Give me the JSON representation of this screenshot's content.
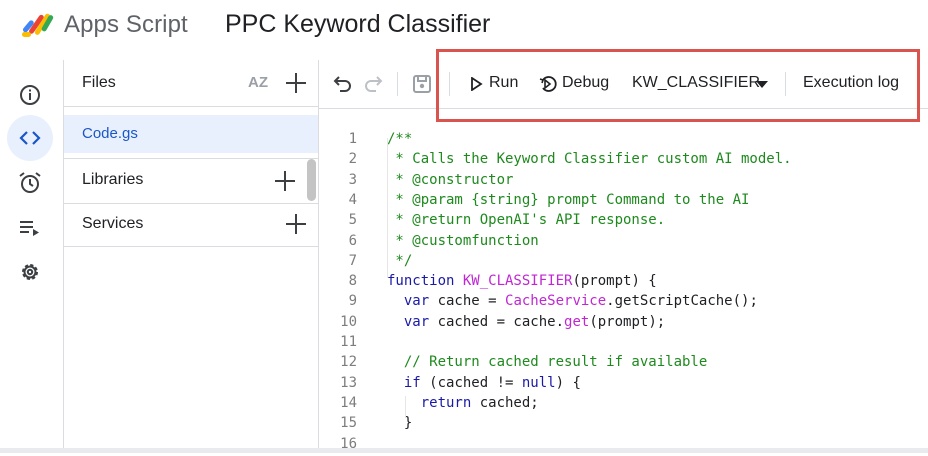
{
  "header": {
    "app_name": "Apps Script",
    "project_title": "PPC Keyword Classifier"
  },
  "rail": {
    "items": [
      "overview",
      "editor",
      "triggers",
      "executions",
      "settings"
    ],
    "active": "editor"
  },
  "files_panel": {
    "title": "Files",
    "files": [
      "Code.gs"
    ],
    "libraries_label": "Libraries",
    "services_label": "Services"
  },
  "toolbar": {
    "run_label": "Run",
    "debug_label": "Debug",
    "function_select": "KW_CLASSIFIER",
    "execution_log_label": "Execution log"
  },
  "code": {
    "lines": [
      {
        "n": "1",
        "parts": [
          {
            "s": "/**",
            "c": "c"
          }
        ]
      },
      {
        "n": "2",
        "parts": [
          {
            "s": " * Calls the Keyword Classifier custom AI model.",
            "c": "c"
          }
        ]
      },
      {
        "n": "3",
        "parts": [
          {
            "s": " * @constructor",
            "c": "c"
          }
        ]
      },
      {
        "n": "4",
        "parts": [
          {
            "s": " * @param {string} prompt Command to the AI",
            "c": "c"
          }
        ]
      },
      {
        "n": "5",
        "parts": [
          {
            "s": " * @return OpenAI's API response.",
            "c": "c"
          }
        ]
      },
      {
        "n": "6",
        "parts": [
          {
            "s": " * @customfunction",
            "c": "c"
          }
        ]
      },
      {
        "n": "7",
        "parts": [
          {
            "s": " */",
            "c": "c"
          }
        ]
      },
      {
        "n": "8",
        "parts": [
          {
            "s": "function ",
            "c": "k"
          },
          {
            "s": "KW_CLASSIFIER",
            "c": "f"
          },
          {
            "s": "(prompt) {",
            "c": "t"
          }
        ]
      },
      {
        "n": "9",
        "parts": [
          {
            "s": "  var ",
            "c": "k"
          },
          {
            "s": "cache = ",
            "c": "t"
          },
          {
            "s": "CacheService",
            "c": "f"
          },
          {
            "s": ".getScriptCache();",
            "c": "t"
          }
        ]
      },
      {
        "n": "10",
        "parts": [
          {
            "s": "  var ",
            "c": "k"
          },
          {
            "s": "cached = cache.",
            "c": "t"
          },
          {
            "s": "get",
            "c": "f"
          },
          {
            "s": "(prompt);",
            "c": "t"
          }
        ]
      },
      {
        "n": "11",
        "parts": []
      },
      {
        "n": "12",
        "parts": [
          {
            "s": "  // Return cached result if available",
            "c": "c"
          }
        ]
      },
      {
        "n": "13",
        "parts": [
          {
            "s": "  if ",
            "c": "k"
          },
          {
            "s": "(cached != ",
            "c": "t"
          },
          {
            "s": "null",
            "c": "k"
          },
          {
            "s": ") {",
            "c": "t"
          }
        ]
      },
      {
        "n": "14",
        "parts": [
          {
            "s": "    return ",
            "c": "k"
          },
          {
            "s": "cached;",
            "c": "t"
          }
        ]
      },
      {
        "n": "15",
        "parts": [
          {
            "s": "  }",
            "c": "t"
          }
        ]
      },
      {
        "n": "16",
        "parts": []
      }
    ]
  }
}
